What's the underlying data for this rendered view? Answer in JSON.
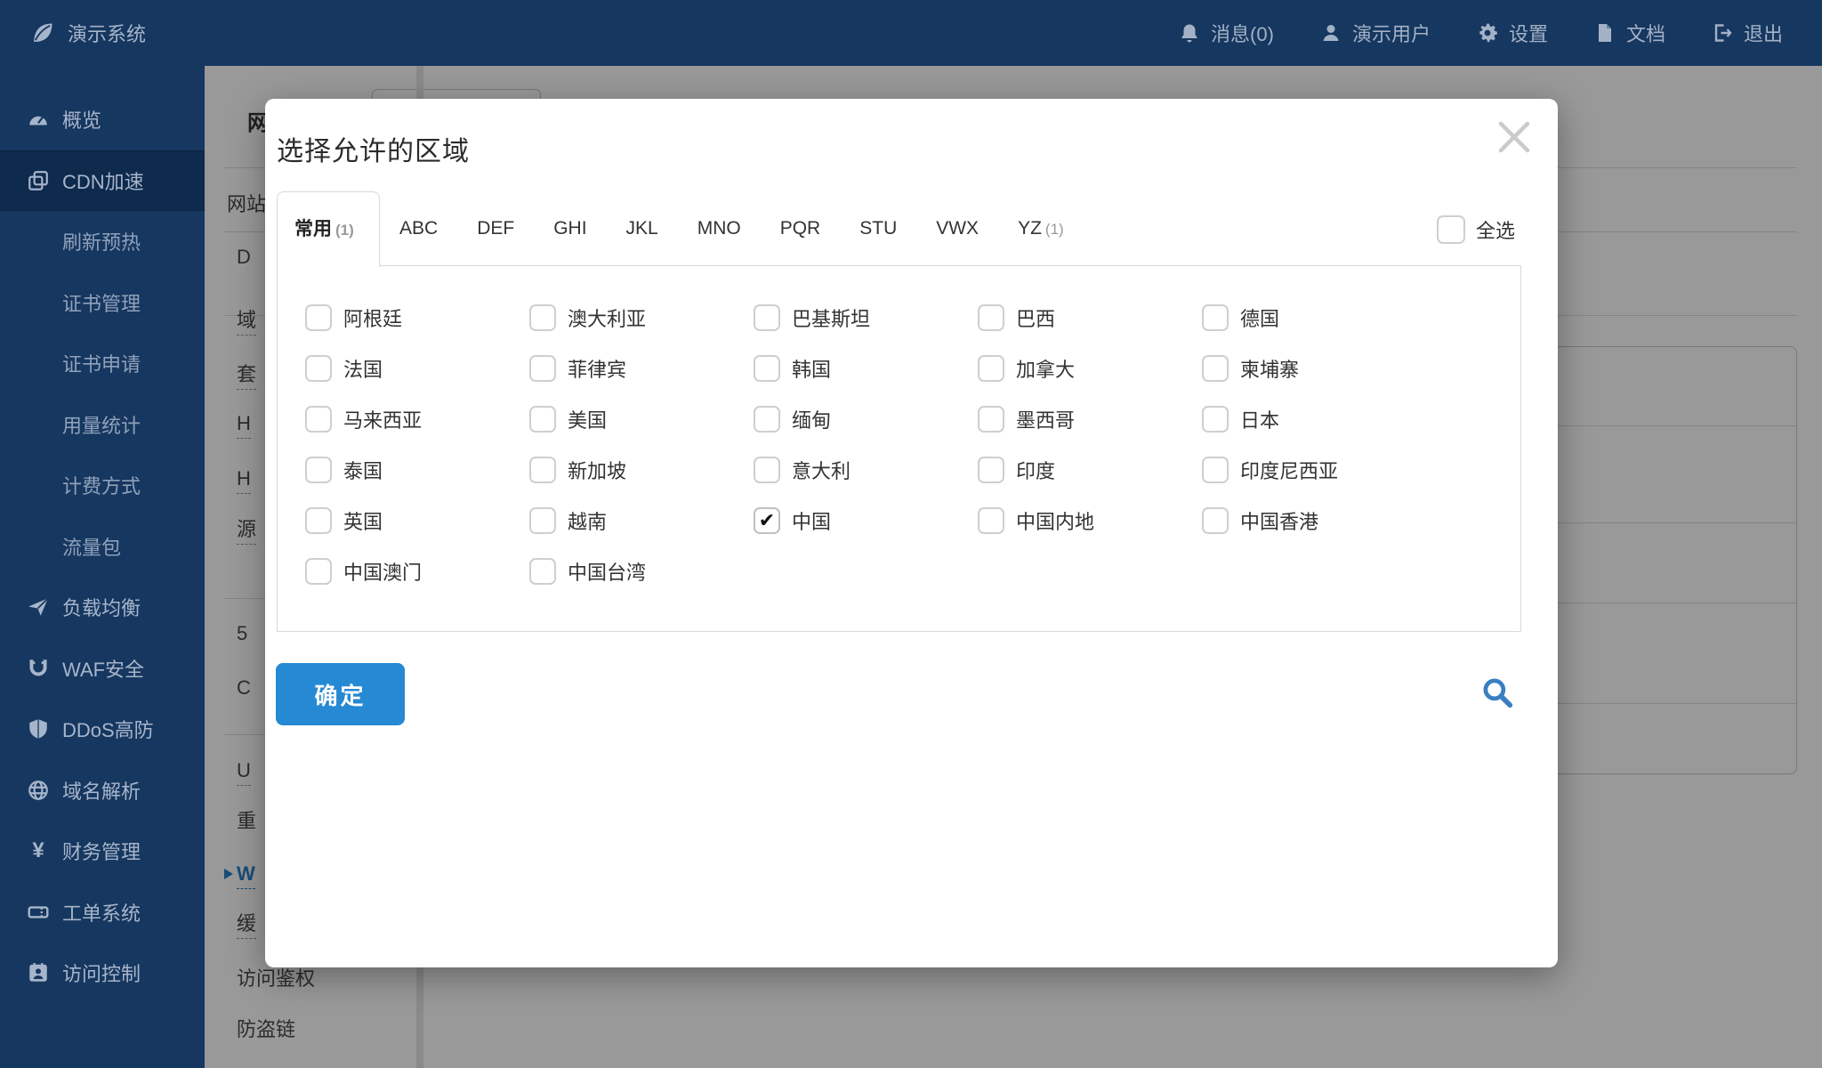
{
  "navbar": {
    "brand": "演示系统",
    "brand_icon": "leaf-icon",
    "items": [
      {
        "icon": "bell-icon",
        "label": "消息(0)"
      },
      {
        "icon": "user-icon",
        "label": "演示用户"
      },
      {
        "icon": "gear-icon",
        "label": "设置"
      },
      {
        "icon": "document-icon",
        "label": "文档"
      },
      {
        "icon": "logout-icon",
        "label": "退出"
      }
    ]
  },
  "sidebar": {
    "items": [
      {
        "icon": "gauge-icon",
        "label": "概览"
      },
      {
        "icon": "layers-icon",
        "label": "CDN加速",
        "active": true
      },
      {
        "label": "刷新预热",
        "sub": true
      },
      {
        "label": "证书管理",
        "sub": true
      },
      {
        "label": "证书申请",
        "sub": true
      },
      {
        "label": "用量统计",
        "sub": true
      },
      {
        "label": "计费方式",
        "sub": true
      },
      {
        "label": "流量包",
        "sub": true
      },
      {
        "icon": "paper-plane-icon",
        "label": "负载均衡"
      },
      {
        "icon": "magnet-icon",
        "label": "WAF安全"
      },
      {
        "icon": "shield-icon",
        "label": "DDoS高防"
      },
      {
        "icon": "globe-icon",
        "label": "域名解析"
      },
      {
        "icon": "yen-icon",
        "label": "财务管理"
      },
      {
        "icon": "ticket-icon",
        "label": "工单系统"
      },
      {
        "icon": "id-card-icon",
        "label": "访问控制"
      }
    ]
  },
  "background": {
    "page_title_fragment": "网",
    "section_fragment": "网站",
    "menu_fragments": [
      {
        "label": "D"
      },
      {
        "label": "域",
        "dashed": true
      },
      {
        "label": "套",
        "dashed": true
      },
      {
        "label": "H",
        "dashed": true
      },
      {
        "label": "H",
        "dashed": true
      },
      {
        "label": "源",
        "dashed": true
      },
      {
        "label": "5"
      },
      {
        "label": "C"
      },
      {
        "label": "U",
        "dashed": true
      },
      {
        "label": "重"
      },
      {
        "label": "W",
        "dashed": true,
        "active": true,
        "arrow": true
      },
      {
        "label": "缓",
        "dashed": true
      },
      {
        "label": "访问鉴权"
      },
      {
        "label": "防盗链"
      }
    ]
  },
  "modal": {
    "title": "选择允许的区域",
    "close_icon": "close-icon",
    "select_all_label": "全选",
    "select_all_checked": false,
    "confirm_label": "确定",
    "search_icon": "search-icon",
    "tabs": [
      {
        "label": "常用",
        "badge": "(1)",
        "active": true
      },
      {
        "label": "ABC"
      },
      {
        "label": "DEF"
      },
      {
        "label": "GHI"
      },
      {
        "label": "JKL"
      },
      {
        "label": "MNO"
      },
      {
        "label": "PQR"
      },
      {
        "label": "STU"
      },
      {
        "label": "VWX"
      },
      {
        "label": "YZ",
        "badge": "(1)"
      }
    ],
    "countries": [
      {
        "name": "阿根廷",
        "checked": false
      },
      {
        "name": "澳大利亚",
        "checked": false
      },
      {
        "name": "巴基斯坦",
        "checked": false
      },
      {
        "name": "巴西",
        "checked": false
      },
      {
        "name": "德国",
        "checked": false
      },
      {
        "name": "法国",
        "checked": false
      },
      {
        "name": "菲律宾",
        "checked": false
      },
      {
        "name": "韩国",
        "checked": false
      },
      {
        "name": "加拿大",
        "checked": false
      },
      {
        "name": "柬埔寨",
        "checked": false
      },
      {
        "name": "马来西亚",
        "checked": false
      },
      {
        "name": "美国",
        "checked": false
      },
      {
        "name": "缅甸",
        "checked": false
      },
      {
        "name": "墨西哥",
        "checked": false
      },
      {
        "name": "日本",
        "checked": false
      },
      {
        "name": "泰国",
        "checked": false
      },
      {
        "name": "新加坡",
        "checked": false
      },
      {
        "name": "意大利",
        "checked": false
      },
      {
        "name": "印度",
        "checked": false
      },
      {
        "name": "印度尼西亚",
        "checked": false
      },
      {
        "name": "英国",
        "checked": false
      },
      {
        "name": "越南",
        "checked": false
      },
      {
        "name": "中国",
        "checked": true
      },
      {
        "name": "中国内地",
        "checked": false
      },
      {
        "name": "中国香港",
        "checked": false
      },
      {
        "name": "中国澳门",
        "checked": false
      },
      {
        "name": "中国台湾",
        "checked": false
      }
    ]
  },
  "colors": {
    "navy": "#16375f",
    "navy_active": "#0e2a4d",
    "accent_blue": "#2589d3",
    "link_blue": "#2b7fc4",
    "search_blue": "#3a7fc2",
    "overlay": "rgba(0,0,0,0.4)"
  }
}
